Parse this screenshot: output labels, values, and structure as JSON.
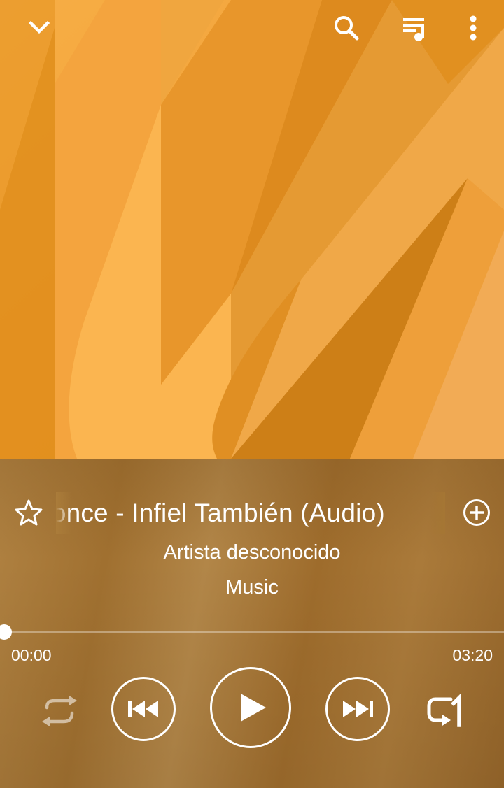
{
  "player": {
    "song_title": "Ponce - Infiel También (Audio)",
    "song_title_prefix": "l ",
    "artist": "Artista desconocido",
    "album": "Music",
    "time_elapsed": "00:00",
    "time_total": "03:20",
    "progress": 0.0
  },
  "icons": {
    "collapse": "chevron-down-icon",
    "search": "search-icon",
    "queue": "queue-music-icon",
    "menu": "more-vert-icon",
    "favorite": "star-outline-icon",
    "add": "add-circle-icon",
    "shuffle": "shuffle-icon",
    "previous": "skip-previous-icon",
    "play": "play-icon",
    "next": "skip-next-icon",
    "repeat": "repeat-one-icon"
  },
  "colors": {
    "art_base": "#f3a63c",
    "panel": "#a8783a",
    "accent": "#ffffff"
  }
}
